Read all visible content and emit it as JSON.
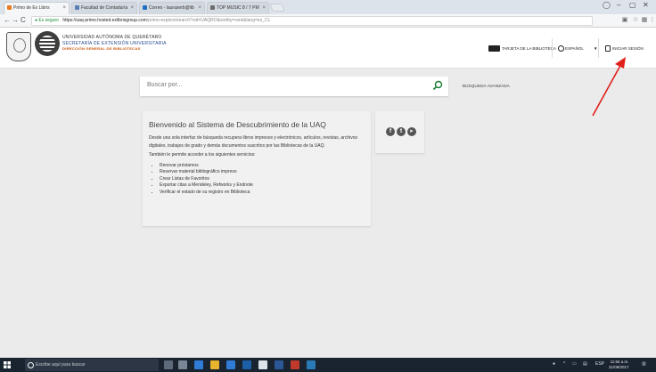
{
  "browser": {
    "tabs": [
      {
        "label": "Primo de Ex Libris",
        "active": true
      },
      {
        "label": "Facultad de Contaduría",
        "active": false
      },
      {
        "label": "Correo - lauraserb@lib",
        "active": false
      },
      {
        "label": "TOP MUSIC 8 / 7 PM",
        "active": false
      }
    ],
    "secure_label": "Es seguro",
    "url_host": "https://uaq-primo.hosted.exlibrisgroup.com",
    "url_path": "/primo-explore/search?vid=UAQRO&sortby=rank&lang=es_CL"
  },
  "header": {
    "institution_line1": "UNIVERSIDAD AUTÓNOMA DE QUERÉTARO",
    "institution_line2": "SECRETARÍA DE EXTENSIÓN UNIVERSITARIA",
    "institution_line3": "DIRECCIÓN GENERAL DE BIBLIOTECAS",
    "library_card_label": "TARJETA DE LA BIBLIOTECA",
    "language_label": "ESPAÑOL",
    "signin_label": "INICIAR SESIÓN"
  },
  "search": {
    "placeholder": "Buscar por...",
    "advanced_label": "BÚSQUEDA AVANZADA"
  },
  "welcome": {
    "title": "Bienvenido al Sistema de Descubrimiento de la UAQ",
    "paragraph1": "Desde una sola interfaz de búsqueda recupera libros impresos y electrónicos, artículos, revistas, archivos digitales, trabajos de grado y demás documentos suscritos por las Bibliotecas de la UAQ.",
    "paragraph2": "También le permite acceder a los siguientes servicios:",
    "services": [
      "Renovar préstamos",
      "Reservar material bibliográfico impreso",
      "Crear Listas de Favoritos",
      "Exportar citas a Mendeley, Refworks y Endnote",
      "Verificar el estado de su registro en Biblioteca"
    ]
  },
  "taskbar": {
    "search_placeholder": "Escribe aquí para buscar",
    "lang_indicator": "ESP",
    "time": "11:56 a.m.",
    "date": "31/08/2017"
  },
  "colors": {
    "page_bg": "#ebebeb",
    "accent_green": "#1d8a3a",
    "annotation_red": "#e0201b",
    "institution_blue": "#2a4d8f",
    "institution_orange": "#c85000"
  }
}
